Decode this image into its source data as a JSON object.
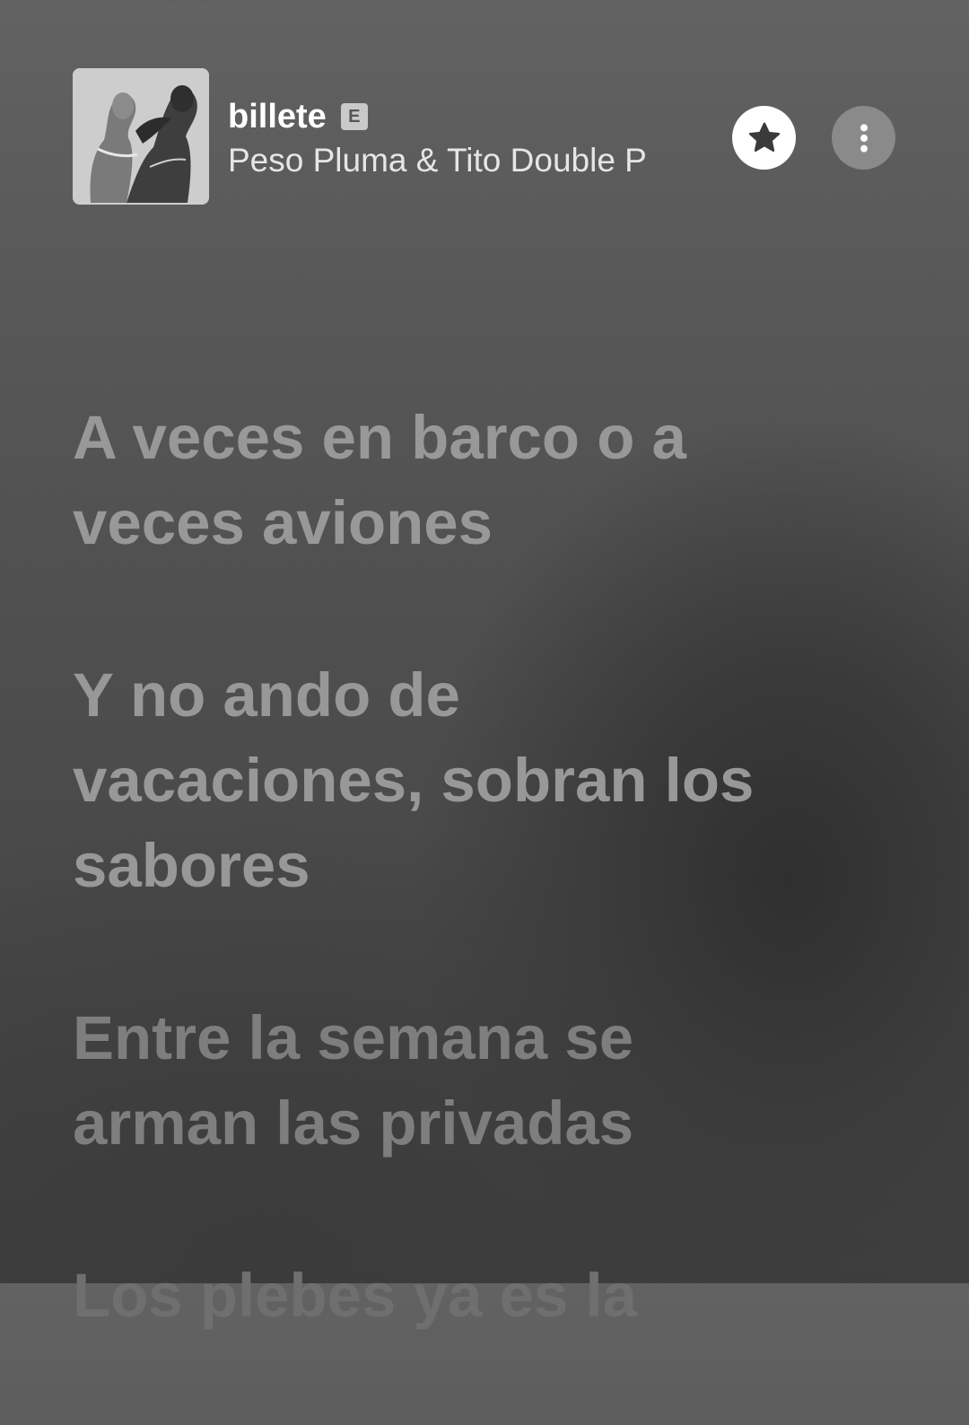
{
  "track": {
    "title": "billete",
    "explicit_badge": "E",
    "artist": "Peso Pluma & Tito Double P",
    "album_art_icon": "album-cover-image"
  },
  "actions": {
    "favorite_icon": "star-icon",
    "more_icon": "more-vertical-icon"
  },
  "lyrics": [
    "A veces en barco o a veces aviones",
    "Y no ando de vacaciones, sobran los sabores",
    "Entre la semana se arman las privadas",
    "Los plebes ya es la"
  ],
  "colors": {
    "lyric_active": "#989898",
    "lyric_dim": "#7e7e7e",
    "favorite_bg": "#ffffff",
    "more_bg": "#8a8a8a"
  }
}
